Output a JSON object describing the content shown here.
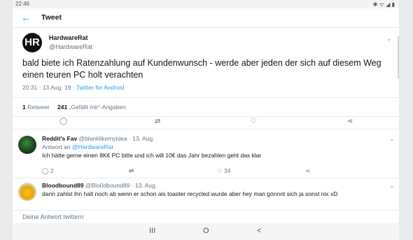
{
  "status_bar": {
    "time": "22:46",
    "system_icons": "✱ ᯤ ◢ ▮"
  },
  "header": {
    "back_icon": "arrow-left-icon",
    "title": "Tweet"
  },
  "main_tweet": {
    "avatar_text": "HR",
    "name": "HardwareRat",
    "handle": "@HardwareRat",
    "text": "bald biete ich Ratenzahlung auf Kundenwunsch - werde aber jeden der sich auf diesem Weg einen teuren PC holt verachten",
    "time": "20:31 · 13 Aug. 19 · ",
    "source": "Twitter for Android",
    "retweets_count": "1",
    "retweets_label": " Retweet",
    "likes_count": "241",
    "likes_label": " „Gefällt mir“-Angaben"
  },
  "replies": [
    {
      "name": "Reddit's Fav",
      "handle_time": " @blanklikemyidea · 13. Aug.",
      "reply_to_prefix": "Antwort an ",
      "reply_to": "@HardwareRat",
      "text": "Ich hätte gerne einen 8K€ PC bitte und ich will 10€ das Jahr bezahlen geht das klar",
      "reply_count": "2",
      "like_count": "34"
    },
    {
      "name": "Bloodbound89",
      "handle_time": " @Blo0dbound89 · 13. Aug.",
      "text": "dann zahlst ihn halt noch ab wenn er  schon als  toaster  recycled  wurde  aber hey man gönnnt sich ja sonst nix xD"
    }
  ],
  "composer": {
    "placeholder": "Deine Antwort twittern"
  },
  "nav": {
    "recents": "III",
    "home": "O",
    "back": "<"
  },
  "colors": {
    "accent": "#1da1f2",
    "text": "#14171a",
    "secondary": "#657786"
  }
}
